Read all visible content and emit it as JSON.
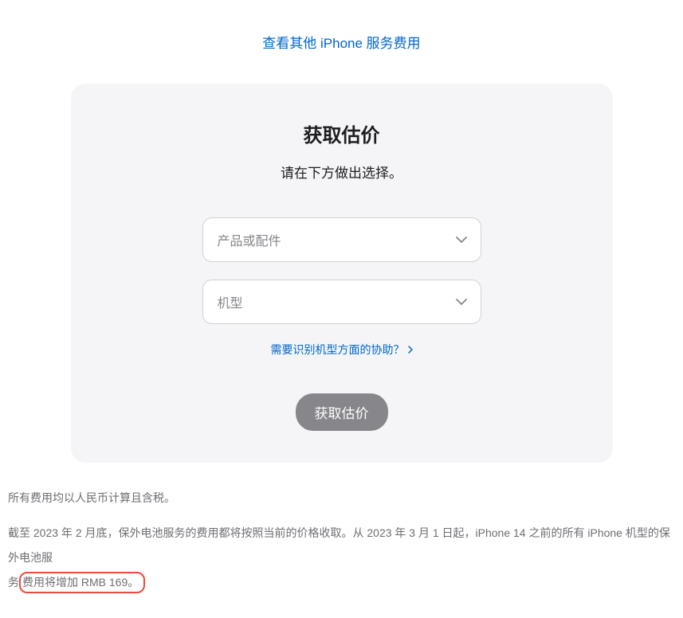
{
  "top_link": {
    "label": "查看其他 iPhone 服务费用"
  },
  "card": {
    "title": "获取估价",
    "subtitle": "请在下方做出选择。",
    "product_select": {
      "placeholder": "产品或配件"
    },
    "model_select": {
      "placeholder": "机型"
    },
    "help_link": {
      "label": "需要识别机型方面的协助？"
    },
    "button": {
      "label": "获取估价"
    }
  },
  "footer": {
    "tax_note": "所有费用均以人民币计算且含税。",
    "notice_part1": "截至 2023 年 2 月底，保外电池服务的费用都将按照当前的价格收取。从 2023 年 3 月 1 日起，iPhone 14 之前的所有 iPhone 机型的保外电池服",
    "notice_part2_prefix": "务",
    "notice_highlighted": "费用将增加 RMB 169。"
  }
}
